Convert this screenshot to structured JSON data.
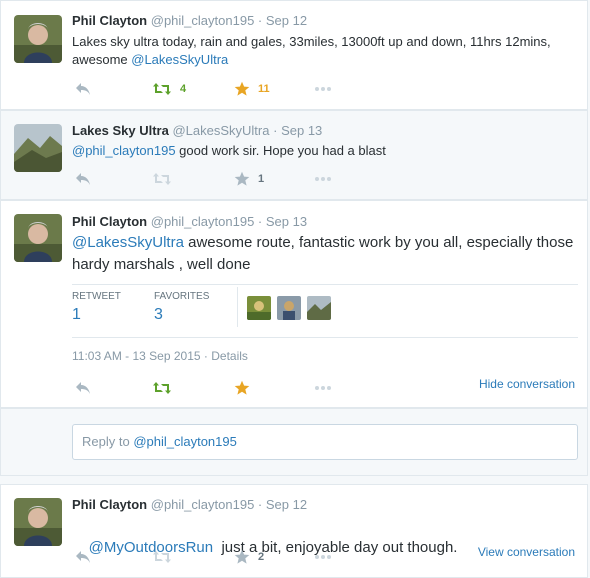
{
  "tweets": [
    {
      "name": "Phil Clayton",
      "handle": "@phil_clayton195",
      "sep": "·",
      "time": "Sep 12",
      "text": "Lakes sky ultra today, rain and gales, 33miles, 13000ft up and down, 11hrs 12mins, awesome ",
      "mention": "@LakesSkyUltra",
      "retweets": "4",
      "favorites": "11"
    },
    {
      "name": "Lakes Sky Ultra",
      "handle": "@LakesSkyUltra",
      "sep": "·",
      "time": "Sep 13",
      "mention": "@phil_clayton195",
      "text": " good work sir. Hope you had a blast",
      "favorites": "1"
    },
    {
      "name": "Phil Clayton",
      "handle": "@phil_clayton195",
      "sep": "·",
      "time": "Sep 13",
      "mention": "@LakesSkyUltra",
      "text": " awesome route, fantastic work by you all, especially those hardy marshals , well done",
      "retweet_label": "RETWEET",
      "retweet_count": "1",
      "favorites_label": "FAVORITES",
      "favorites_count": "3",
      "timestamp": "11:03 AM - 13 Sep 2015",
      "details_sep": "·",
      "details": "Details",
      "hide_conversation": "Hide conversation",
      "reply_prefix": "Reply to ",
      "reply_handle": "@phil_clayton195"
    },
    {
      "name": "Phil Clayton",
      "handle": "@phil_clayton195",
      "sep": "·",
      "time": "Sep 12",
      "mention": "@MyOutdoorsRun",
      "text": "  just a bit, enjoyable day out though.",
      "favorites": "2",
      "view_conversation": "View conversation"
    }
  ],
  "colors": {
    "link": "#2b7bb9",
    "retweet_active": "#5da12b",
    "favorite_active": "#e8a524",
    "icon_grey": "#aab8c2"
  }
}
